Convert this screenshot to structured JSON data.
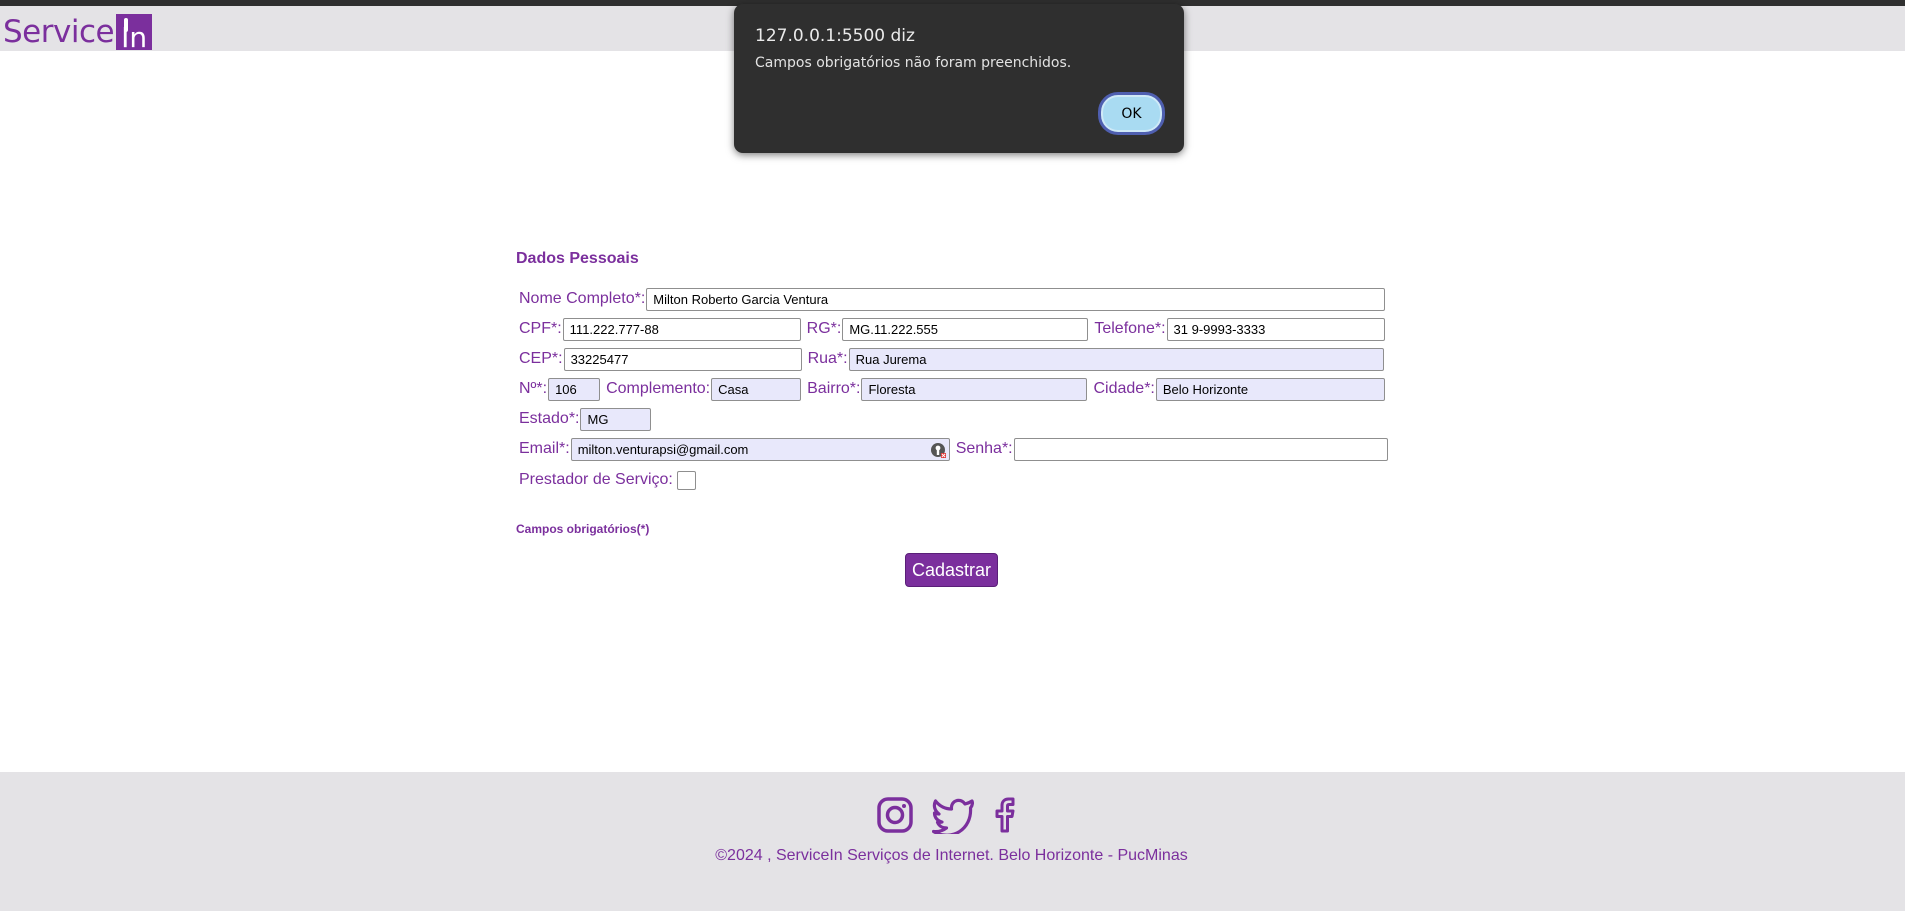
{
  "header": {
    "logo_text": "Service",
    "logo_mark": "In"
  },
  "form": {
    "section_title": "Dados Pessoais",
    "fields": {
      "nome": {
        "label": "Nome Completo*:",
        "value": "Milton Roberto Garcia Ventura"
      },
      "cpf": {
        "label": "CPF*:",
        "value": "111.222.777-88"
      },
      "rg": {
        "label": "RG*:",
        "value": "MG.11.222.555"
      },
      "telefone": {
        "label": "Telefone*:",
        "value": "31 9-9993-3333"
      },
      "cep": {
        "label": "CEP*:",
        "value": "33225477"
      },
      "rua": {
        "label": "Rua*:",
        "value": "Rua Jurema"
      },
      "numero": {
        "label": "Nº*:",
        "value": "106"
      },
      "complemento": {
        "label": "Complemento:",
        "value": "Casa"
      },
      "bairro": {
        "label": "Bairro*:",
        "value": "Floresta"
      },
      "cidade": {
        "label": "Cidade*:",
        "value": "Belo Horizonte"
      },
      "estado": {
        "label": "Estado*:",
        "value": "MG"
      },
      "email": {
        "label": "Email*:",
        "value": "milton.venturapsi@gmail.com"
      },
      "senha": {
        "label": "Senha*:",
        "value": ""
      },
      "prestador": {
        "label": "Prestador de Serviço:"
      }
    },
    "required_note": "Campos obrigatórios(*)",
    "submit_label": "Cadastrar"
  },
  "footer": {
    "social_icons": [
      "instagram-icon",
      "twitter-icon",
      "facebook-icon"
    ],
    "copyright": "©2024 , ServiceIn Serviços de Internet. Belo Horizonte - PucMinas"
  },
  "dialog": {
    "title": "127.0.0.1:5500 diz",
    "message": "Campos obrigatórios não foram preenchidos.",
    "ok_label": "OK"
  },
  "colors": {
    "brand": "#7b2f9d",
    "header_bg": "#e4e3e6",
    "autofill_bg": "#e8e8fb",
    "dialog_bg": "#2f2f2f",
    "ok_button_bg": "#a9dbf2"
  }
}
